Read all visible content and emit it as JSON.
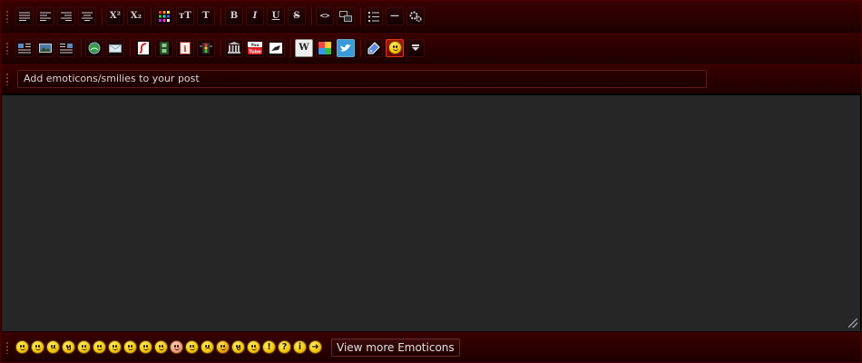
{
  "toolbar_row1": {
    "buttons": [
      {
        "name": "align-justify-button",
        "icon": "align-justify-icon"
      },
      {
        "name": "align-left-button",
        "icon": "align-left-icon"
      },
      {
        "name": "align-right-button",
        "icon": "align-right-icon"
      },
      {
        "name": "align-center-button",
        "icon": "align-center-icon"
      },
      {
        "name": "superscript-button",
        "label": "X²"
      },
      {
        "name": "subscript-button",
        "label": "X₂"
      },
      {
        "name": "color-button",
        "icon": "color-grid-icon"
      },
      {
        "name": "font-size-button",
        "label": "тT"
      },
      {
        "name": "font-button",
        "label": "T"
      },
      {
        "name": "bold-button",
        "label": "B"
      },
      {
        "name": "italic-button",
        "label": "I"
      },
      {
        "name": "underline-button",
        "label": "U"
      },
      {
        "name": "strike-button",
        "label": "S"
      },
      {
        "name": "code-button",
        "label": "<>"
      },
      {
        "name": "quote-button",
        "icon": "quote-icon"
      },
      {
        "name": "list-button",
        "icon": "list-icon"
      },
      {
        "name": "hr-button",
        "label": "—"
      },
      {
        "name": "settings-button",
        "icon": "gears-icon"
      }
    ]
  },
  "toolbar_row2": {
    "buttons": [
      {
        "name": "image-left-button",
        "icon": "image-left-icon"
      },
      {
        "name": "image-button",
        "icon": "image-icon"
      },
      {
        "name": "image-right-button",
        "icon": "image-right-icon"
      },
      {
        "name": "link-button",
        "icon": "globe-link-icon"
      },
      {
        "name": "email-button",
        "icon": "mail-icon"
      },
      {
        "name": "flash-button",
        "icon": "flash-icon"
      },
      {
        "name": "video-button",
        "icon": "film-icon"
      },
      {
        "name": "info-button",
        "icon": "info-icon"
      },
      {
        "name": "traffic-button",
        "icon": "traffic-light-icon"
      },
      {
        "name": "museum-button",
        "icon": "building-icon"
      },
      {
        "name": "youtube-button",
        "label": "You Tube"
      },
      {
        "name": "gamepad-button",
        "icon": "gamepad-icon"
      },
      {
        "name": "wikipedia-button",
        "label": "W"
      },
      {
        "name": "google-button",
        "icon": "google-icon"
      },
      {
        "name": "twitter-button",
        "icon": "twitter-bird-icon"
      },
      {
        "name": "tag-button",
        "icon": "tag-icon"
      },
      {
        "name": "emoticon-button",
        "icon": "smiley-icon",
        "active": true
      },
      {
        "name": "more-button",
        "icon": "chevron-down-icon"
      }
    ]
  },
  "hint": {
    "text": "Add emoticons/smilies to your post"
  },
  "emoticons": {
    "items": [
      "biggrin",
      "smile",
      "frown",
      "surprised",
      "crazy",
      "rolleyes",
      "cool",
      "grin",
      "tongue",
      "laugh",
      "blush",
      "confused",
      "mad",
      "evil",
      "eek",
      "wink",
      "exclaim",
      "question",
      "idea",
      "arrow"
    ],
    "view_more_label": "View more Emoticons"
  },
  "colors": {
    "toolbar_bg": "#2a0000",
    "content_bg": "#262626",
    "active_button": "#a81a00"
  }
}
